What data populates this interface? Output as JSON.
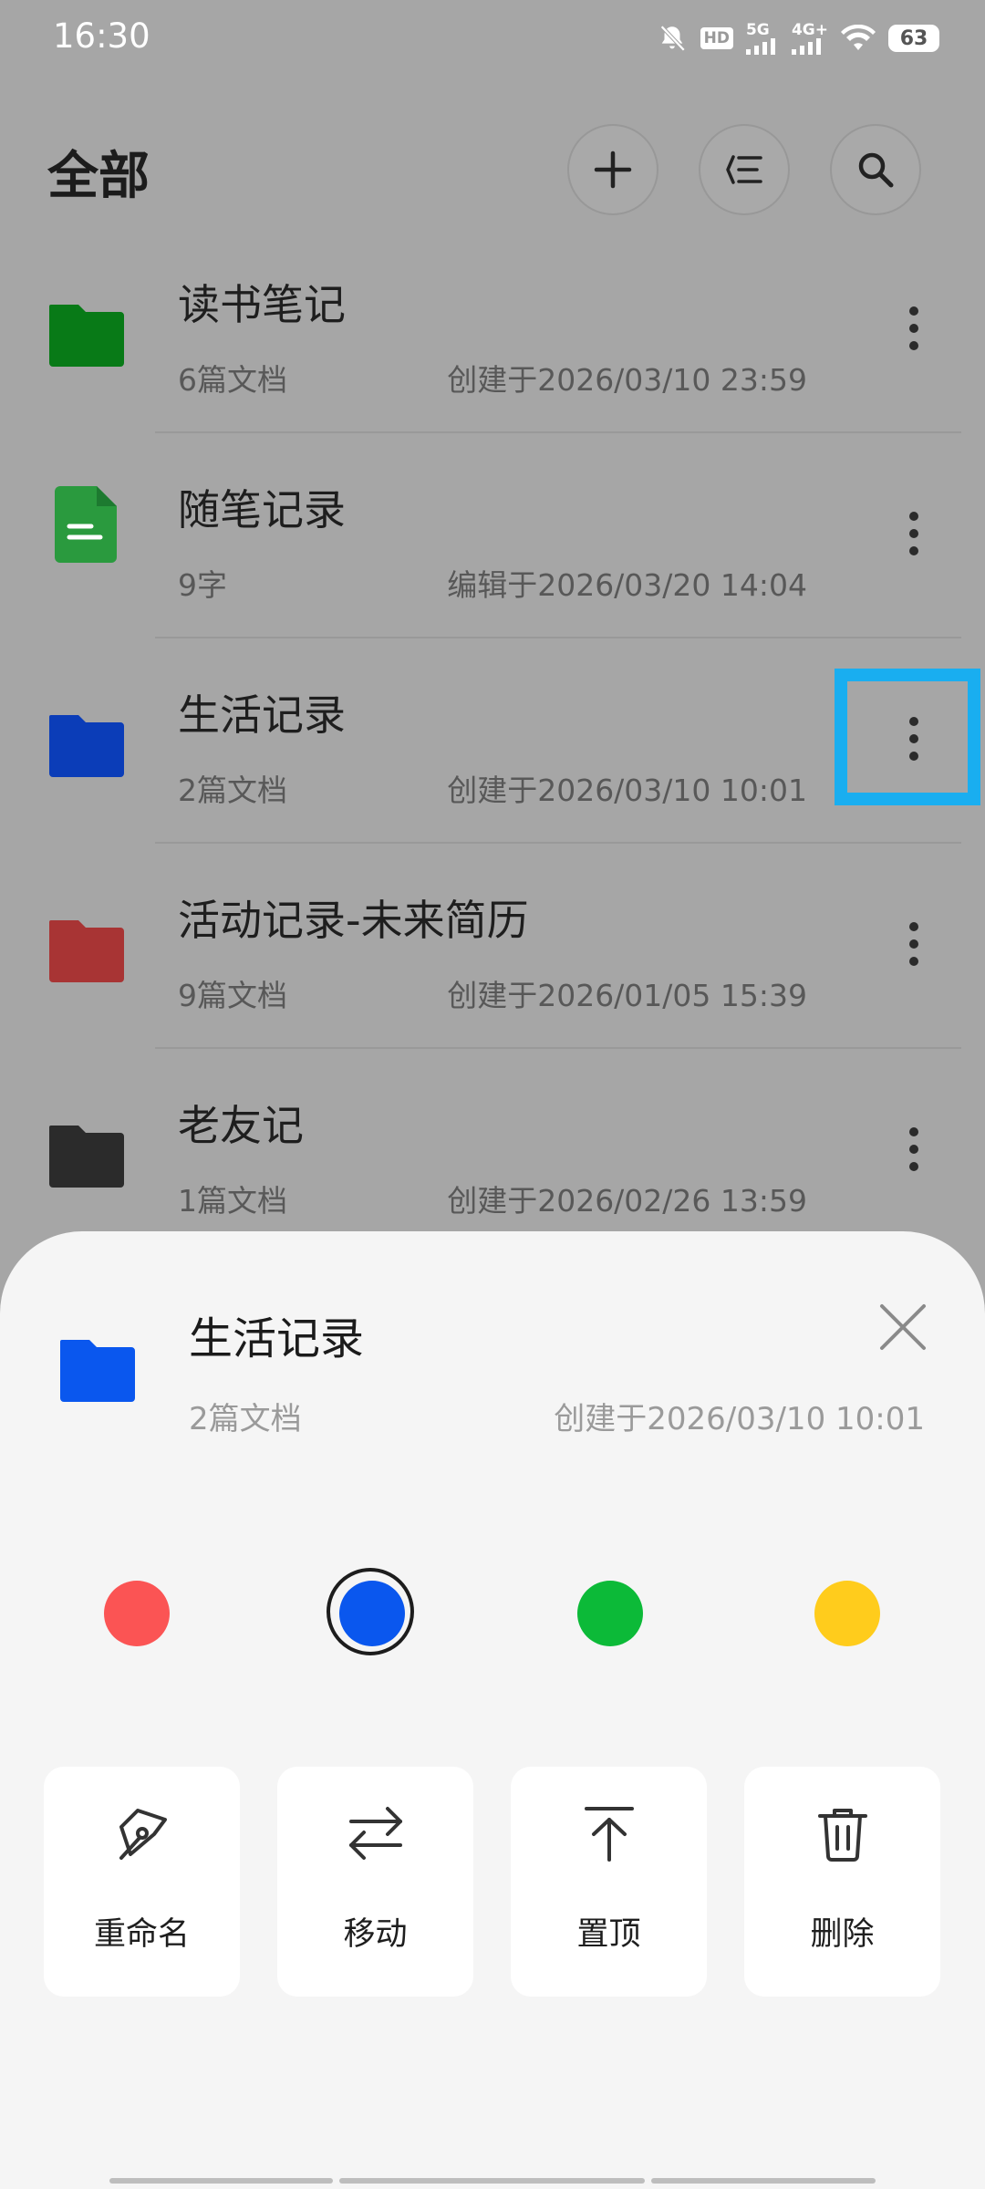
{
  "status_bar": {
    "time": "16:30",
    "icons": [
      "bell-muted-icon",
      "hd-icon",
      "signal-5g-icon",
      "signal-4g-icon",
      "wifi-icon"
    ],
    "hd_label": "HD",
    "net1_label": "5G",
    "net2_label": "4G+",
    "battery": "63"
  },
  "header": {
    "title": "全部",
    "actions": [
      "plus-icon",
      "sort-icon",
      "search-icon"
    ]
  },
  "list": {
    "items": [
      {
        "name": "读书笔记",
        "meta": "6篇文档",
        "date": "创建于2026/03/10 23:59",
        "type": "folder",
        "color": "#087a17"
      },
      {
        "name": "随笔记录",
        "meta": "9字",
        "date": "编辑于2026/03/20 14:04",
        "type": "document",
        "color": "#2a9a3e"
      },
      {
        "name": "生活记录",
        "meta": "2篇文档",
        "date": "创建于2026/03/10 10:01",
        "type": "folder",
        "color": "#0b3db8"
      },
      {
        "name": "活动记录-未来简历",
        "meta": "9篇文档",
        "date": "创建于2026/01/05 15:39",
        "type": "folder",
        "color": "#a83434"
      },
      {
        "name": "老友记",
        "meta": "1篇文档",
        "date": "创建于2026/02/26 13:59",
        "type": "folder",
        "color": "#2b2b2b"
      }
    ]
  },
  "sheet": {
    "title": "生活记录",
    "meta": "2篇文档",
    "date": "创建于2026/03/10 10:01",
    "folder_color": "#0a57ee",
    "colors": [
      "#fb5454",
      "#0a57ee",
      "#0cba38",
      "#ffcc1c"
    ],
    "selected_color": "#0a57ee",
    "actions": [
      {
        "label": "重命名",
        "icon": "pen-icon"
      },
      {
        "label": "移动",
        "icon": "move-arrows-icon"
      },
      {
        "label": "置顶",
        "icon": "pin-top-icon"
      },
      {
        "label": "删除",
        "icon": "trash-icon"
      }
    ]
  }
}
